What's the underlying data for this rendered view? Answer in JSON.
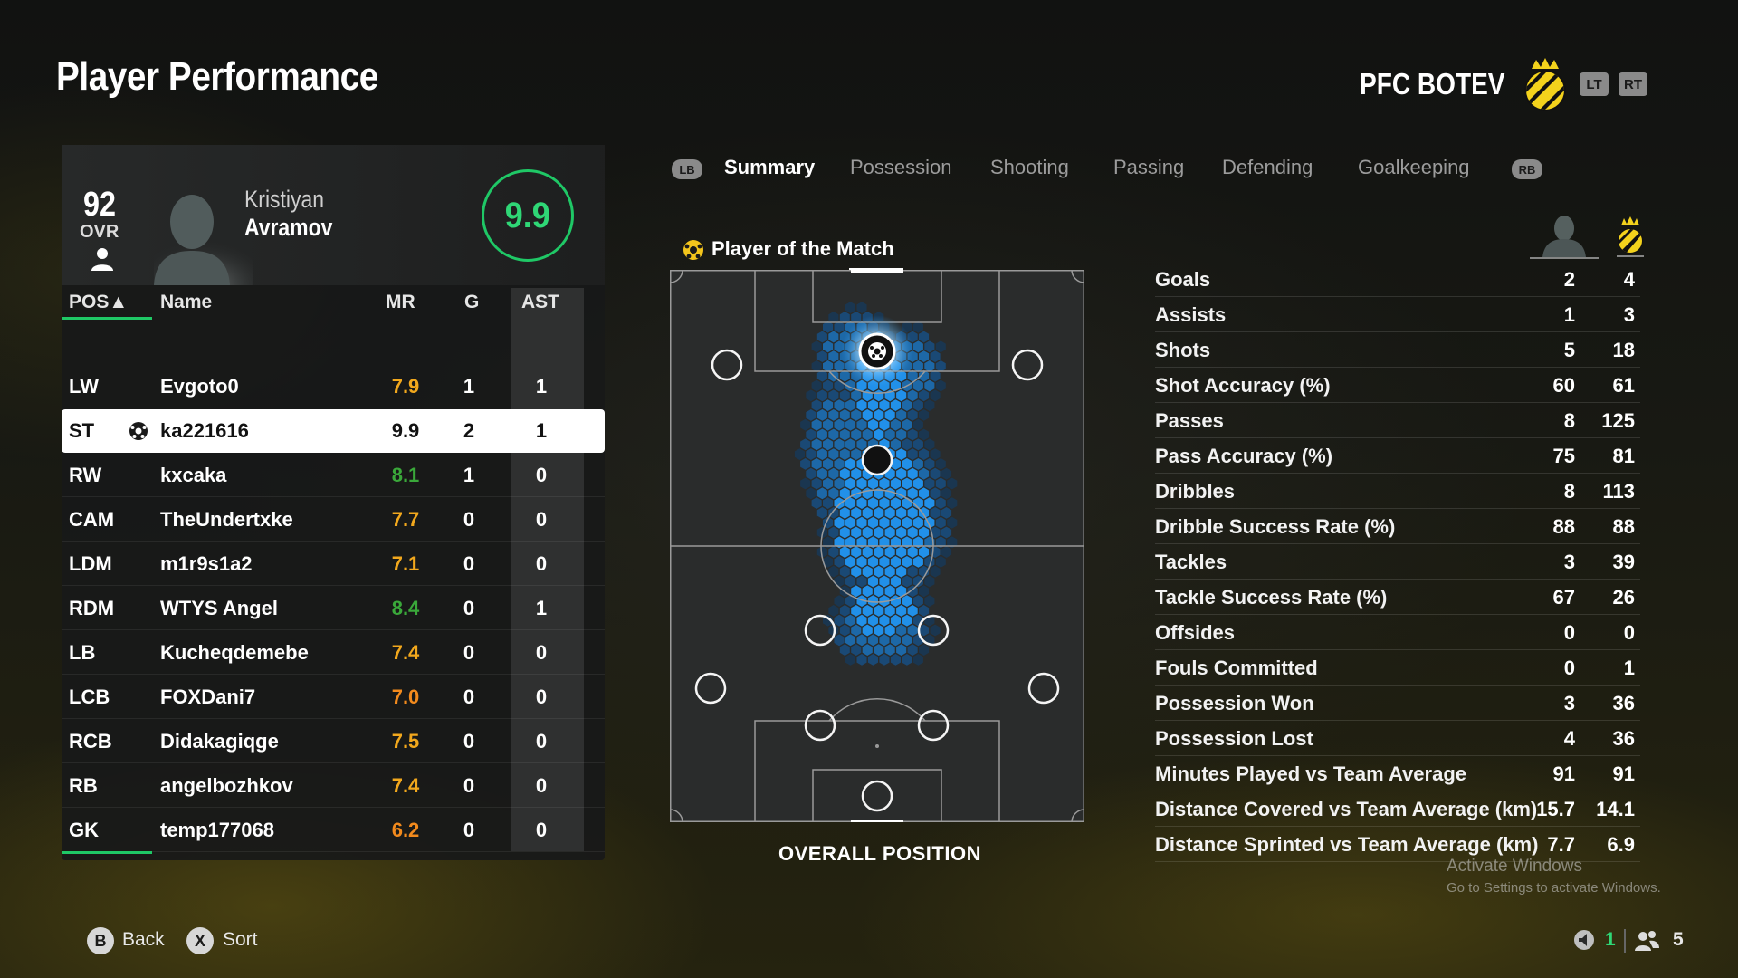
{
  "page": {
    "title": "Player Performance"
  },
  "club": {
    "name": "PFC BOTEV",
    "lt_label": "LT",
    "rt_label": "RT"
  },
  "player": {
    "ovr": "92",
    "ovr_label": "OVR",
    "first_name": "Kristiyan",
    "last_name": "Avramov",
    "match_rating": "9.9"
  },
  "table": {
    "headers": {
      "pos": "POS▲",
      "name": "Name",
      "mr": "MR",
      "g": "G",
      "ast": "AST"
    },
    "rows": [
      {
        "pos": "LW",
        "name": "Evgoto0",
        "mr": "7.9",
        "mr_color": "#f2a81d",
        "g": "1",
        "ast": "1"
      },
      {
        "pos": "ST",
        "name": "ka221616",
        "mr": "9.9",
        "mr_color": "#121212",
        "g": "2",
        "ast": "1",
        "highlighted": true
      },
      {
        "pos": "RW",
        "name": "kxcaka",
        "mr": "8.1",
        "mr_color": "#3aa83a",
        "g": "1",
        "ast": "0"
      },
      {
        "pos": "CAM",
        "name": "TheUndertxke",
        "mr": "7.7",
        "mr_color": "#f2a81d",
        "g": "0",
        "ast": "0"
      },
      {
        "pos": "LDM",
        "name": "m1r9s1a2",
        "mr": "7.1",
        "mr_color": "#f2a81d",
        "g": "0",
        "ast": "0"
      },
      {
        "pos": "RDM",
        "name": "WTYS Angel",
        "mr": "8.4",
        "mr_color": "#3aa83a",
        "g": "0",
        "ast": "1"
      },
      {
        "pos": "LB",
        "name": "Kucheqdemebe",
        "mr": "7.4",
        "mr_color": "#f2a81d",
        "g": "0",
        "ast": "0"
      },
      {
        "pos": "LCB",
        "name": "FOXDani7",
        "mr": "7.0",
        "mr_color": "#f28a1d",
        "g": "0",
        "ast": "0"
      },
      {
        "pos": "RCB",
        "name": "Didakagiqge",
        "mr": "7.5",
        "mr_color": "#f2a81d",
        "g": "0",
        "ast": "0"
      },
      {
        "pos": "RB",
        "name": "angelbozhkov",
        "mr": "7.4",
        "mr_color": "#f2a81d",
        "g": "0",
        "ast": "0"
      },
      {
        "pos": "GK",
        "name": "temp177068",
        "mr": "6.2",
        "mr_color": "#f28a1d",
        "g": "0",
        "ast": "0"
      }
    ]
  },
  "tabs": {
    "lb_label": "LB",
    "rb_label": "RB",
    "items": [
      "Summary",
      "Possession",
      "Shooting",
      "Passing",
      "Defending",
      "Goalkeeping"
    ],
    "active": "Summary"
  },
  "pitch": {
    "potm_label": "Player of the Match",
    "caption": "OVERALL POSITION"
  },
  "stats": [
    {
      "label": "Goals",
      "player": "2",
      "team": "4"
    },
    {
      "label": "Assists",
      "player": "1",
      "team": "3"
    },
    {
      "label": "Shots",
      "player": "5",
      "team": "18"
    },
    {
      "label": "Shot Accuracy (%)",
      "player": "60",
      "team": "61"
    },
    {
      "label": "Passes",
      "player": "8",
      "team": "125"
    },
    {
      "label": "Pass Accuracy (%)",
      "player": "75",
      "team": "81"
    },
    {
      "label": "Dribbles",
      "player": "8",
      "team": "113"
    },
    {
      "label": "Dribble Success Rate (%)",
      "player": "88",
      "team": "88"
    },
    {
      "label": "Tackles",
      "player": "3",
      "team": "39"
    },
    {
      "label": "Tackle Success Rate (%)",
      "player": "67",
      "team": "26"
    },
    {
      "label": "Offsides",
      "player": "0",
      "team": "0"
    },
    {
      "label": "Fouls Committed",
      "player": "0",
      "team": "1"
    },
    {
      "label": "Possession Won",
      "player": "3",
      "team": "36"
    },
    {
      "label": "Possession Lost",
      "player": "4",
      "team": "36"
    },
    {
      "label": "Minutes Played vs Team Average",
      "player": "91",
      "team": "91"
    },
    {
      "label": "Distance Covered vs Team Average (km)",
      "player": "15.7",
      "team": "14.1"
    },
    {
      "label": "Distance Sprinted vs Team Average (km)",
      "player": "7.7",
      "team": "6.9"
    }
  ],
  "watermark": {
    "line1": "Activate Windows",
    "line2": "Go to Settings to activate Windows."
  },
  "footer": {
    "back_key": "B",
    "back_label": "Back",
    "sort_key": "X",
    "sort_label": "Sort",
    "mic_count": "1",
    "party_count": "5"
  },
  "colors": {
    "accent_green": "#1fc866",
    "heat_blue": "#2a9df5",
    "club_yellow": "#f3d21c"
  }
}
